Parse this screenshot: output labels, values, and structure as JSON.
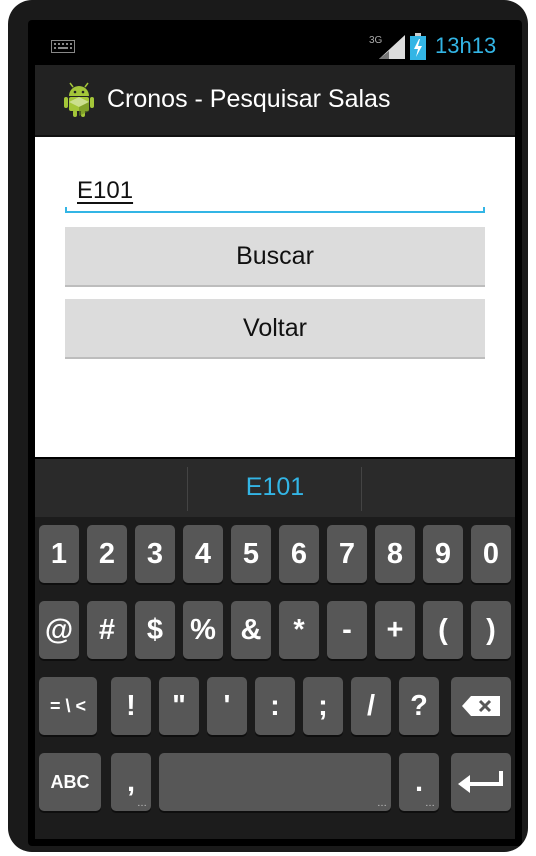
{
  "status": {
    "network": "3G",
    "time": "13h13"
  },
  "actionbar": {
    "title": "Cronos - Pesquisar Salas",
    "icon": "android-robot-icon"
  },
  "form": {
    "search_value": "E101",
    "search_button": "Buscar",
    "back_button": "Voltar"
  },
  "keyboard": {
    "suggestion": "E101",
    "row1": [
      "1",
      "2",
      "3",
      "4",
      "5",
      "6",
      "7",
      "8",
      "9",
      "0"
    ],
    "row2": [
      "@",
      "#",
      "$",
      "%",
      "&",
      "*",
      "-",
      "+",
      "(",
      ")"
    ],
    "row3": [
      "= \\ <",
      "!",
      "\"",
      "'",
      ":",
      ";",
      "/",
      "?"
    ],
    "row4": {
      "abc": "ABC",
      "comma": ",",
      "period": "."
    },
    "icons": [
      "backspace-icon",
      "enter-icon"
    ]
  },
  "colors": {
    "accent": "#33b5e5",
    "actionbar": "#222222",
    "key": "#575757"
  }
}
